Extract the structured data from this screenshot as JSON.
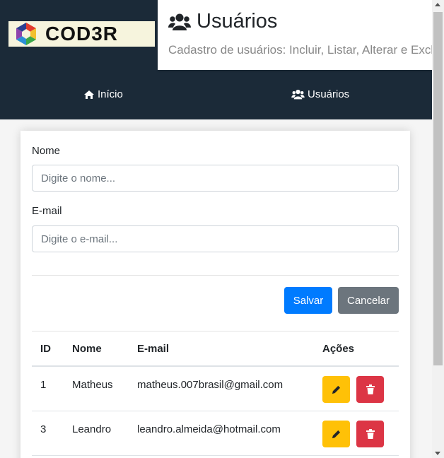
{
  "logo": {
    "text": "COD3R"
  },
  "header": {
    "title": "Usuários",
    "subtitle": "Cadastro de usuários: Incluir, Listar, Alterar e Excluir!"
  },
  "nav": {
    "items": [
      {
        "label": "Início",
        "icon": "home-icon"
      },
      {
        "label": "Usuários",
        "icon": "users-icon"
      }
    ]
  },
  "form": {
    "name_label": "Nome",
    "name_placeholder": "Digite o nome...",
    "email_label": "E-mail",
    "email_placeholder": "Digite o e-mail...",
    "save_label": "Salvar",
    "cancel_label": "Cancelar"
  },
  "table": {
    "headers": {
      "id": "ID",
      "name": "Nome",
      "email": "E-mail",
      "actions": "Ações"
    },
    "rows": [
      {
        "id": "1",
        "name": "Matheus",
        "email": "matheus.007brasil@gmail.com"
      },
      {
        "id": "3",
        "name": "Leandro",
        "email": "leandro.almeida@hotmail.com"
      }
    ]
  },
  "colors": {
    "dark": "#1b2a38",
    "primary": "#007bff",
    "secondary": "#6c757d",
    "warning": "#ffc107",
    "danger": "#dc3545"
  }
}
